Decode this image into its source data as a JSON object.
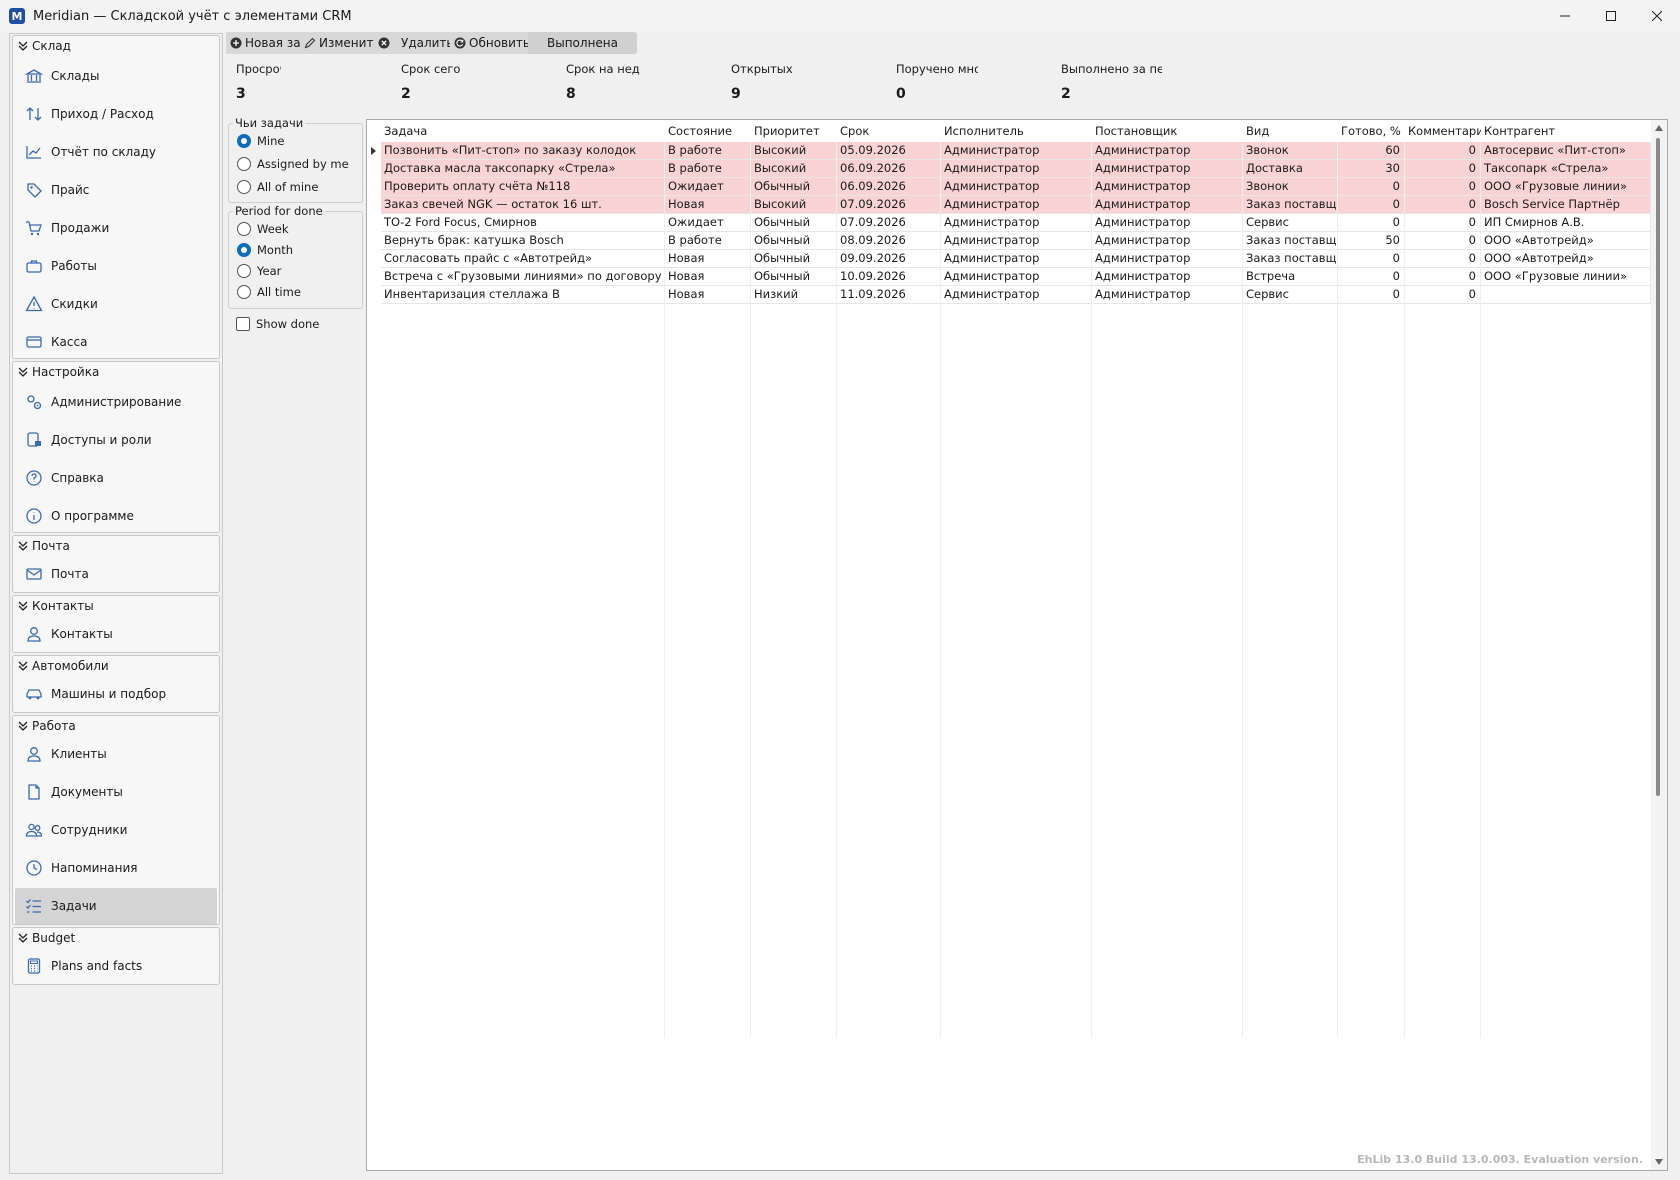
{
  "window": {
    "title": "Meridian — Складской учёт с элементами CRM",
    "icon_letter": "M"
  },
  "nav": {
    "groups": [
      {
        "title": "Склад",
        "items": [
          {
            "label": "Склады",
            "icon": "bank-icon"
          },
          {
            "label": "Приход / Расход",
            "icon": "arrows-updown-icon"
          },
          {
            "label": "Отчёт по складу",
            "icon": "chart-icon"
          },
          {
            "label": "Прайс",
            "icon": "tag-icon"
          },
          {
            "label": "Продажи",
            "icon": "cart-icon"
          },
          {
            "label": "Работы",
            "icon": "briefcase-icon"
          },
          {
            "label": "Скидки",
            "icon": "warning-icon"
          },
          {
            "label": "Касса",
            "icon": "wallet-icon"
          }
        ]
      },
      {
        "title": "Настройка",
        "items": [
          {
            "label": "Администрирование",
            "icon": "gears-icon"
          },
          {
            "label": "Доступы и роли",
            "icon": "user-lock-icon"
          },
          {
            "label": "Справка",
            "icon": "help-icon"
          },
          {
            "label": "О программе",
            "icon": "info-icon"
          }
        ]
      },
      {
        "title": "Почта",
        "items": [
          {
            "label": "Почта",
            "icon": "mail-icon"
          }
        ]
      },
      {
        "title": "Контакты",
        "items": [
          {
            "label": "Контакты",
            "icon": "person-icon"
          }
        ]
      },
      {
        "title": "Автомобили",
        "items": [
          {
            "label": "Машины и подбор",
            "icon": "car-icon"
          }
        ]
      },
      {
        "title": "Работа",
        "items": [
          {
            "label": "Клиенты",
            "icon": "person-icon"
          },
          {
            "label": "Документы",
            "icon": "document-icon"
          },
          {
            "label": "Сотрудники",
            "icon": "people-icon"
          },
          {
            "label": "Напоминания",
            "icon": "clock-icon"
          },
          {
            "label": "Задачи",
            "icon": "tasks-icon",
            "active": true
          }
        ]
      },
      {
        "title": "Budget",
        "items": [
          {
            "label": "Plans and facts",
            "icon": "calculator-icon"
          }
        ]
      }
    ]
  },
  "toolbar": {
    "new_task": "Новая задача",
    "edit": "Изменить",
    "delete": "Удалить",
    "refresh": "Обновить",
    "done": "Выполнена"
  },
  "stats": [
    {
      "label": "Просрочено",
      "value": "3"
    },
    {
      "label": "Срок сегодня",
      "value": "2"
    },
    {
      "label": "Срок на неделе",
      "value": "8"
    },
    {
      "label": "Открытых у меня",
      "value": "9"
    },
    {
      "label": "Поручено мной",
      "value": "0"
    },
    {
      "label": "Выполнено за период",
      "value": "2"
    }
  ],
  "filters": {
    "whose_title": "Чьи задачи",
    "whose_options": [
      "Mine",
      "Assigned by me",
      "All of mine"
    ],
    "whose_selected": 0,
    "period_title": "Period for done",
    "period_options": [
      "Week",
      "Month",
      "Year",
      "All time"
    ],
    "period_selected": 1,
    "show_done_label": "Show done",
    "show_done_checked": false
  },
  "grid": {
    "columns": [
      "Задача",
      "Состояние",
      "Приоритет",
      "Срок",
      "Исполнитель",
      "Постановщик",
      "Вид",
      "Готово, %",
      "Комментарии",
      "Контрагент"
    ],
    "rows": [
      {
        "overdue": true,
        "cells": [
          "Позвонить «Пит-стоп» по заказу колодок",
          "В работе",
          "Высокий",
          "05.09.2026",
          "Администратор",
          "Администратор",
          "Звонок",
          "60",
          "0",
          "Автосервис «Пит-стоп»"
        ]
      },
      {
        "overdue": true,
        "cells": [
          "Доставка масла таксопарку «Стрела»",
          "В работе",
          "Высокий",
          "06.09.2026",
          "Администратор",
          "Администратор",
          "Доставка",
          "30",
          "0",
          "Таксопарк «Стрела»"
        ]
      },
      {
        "overdue": true,
        "cells": [
          "Проверить оплату счёта №118",
          "Ожидает",
          "Обычный",
          "06.09.2026",
          "Администратор",
          "Администратор",
          "Звонок",
          "0",
          "0",
          "ООО «Грузовые линии»"
        ]
      },
      {
        "overdue": true,
        "cells": [
          "Заказ свечей NGK — остаток 16 шт.",
          "Новая",
          "Высокий",
          "07.09.2026",
          "Администратор",
          "Администратор",
          "Заказ поставщику",
          "0",
          "0",
          "Bosch Service Партнёр"
        ]
      },
      {
        "overdue": false,
        "cells": [
          "ТО-2 Ford Focus, Смирнов",
          "Ожидает",
          "Обычный",
          "07.09.2026",
          "Администратор",
          "Администратор",
          "Сервис",
          "0",
          "0",
          "ИП Смирнов А.В."
        ]
      },
      {
        "overdue": false,
        "cells": [
          "Вернуть брак: катушка Bosch",
          "В работе",
          "Обычный",
          "08.09.2026",
          "Администратор",
          "Администратор",
          "Заказ поставщику",
          "50",
          "0",
          "ООО «Автотрейд»"
        ]
      },
      {
        "overdue": false,
        "cells": [
          "Согласовать прайс с «Автотрейд»",
          "Новая",
          "Обычный",
          "09.09.2026",
          "Администратор",
          "Администратор",
          "Заказ поставщику",
          "0",
          "0",
          "ООО «Автотрейд»"
        ]
      },
      {
        "overdue": false,
        "cells": [
          "Встреча с «Грузовыми линиями» по договору",
          "Новая",
          "Обычный",
          "10.09.2026",
          "Администратор",
          "Администратор",
          "Встреча",
          "0",
          "0",
          "ООО «Грузовые линии»"
        ]
      },
      {
        "overdue": false,
        "cells": [
          "Инвентаризация стеллажа B",
          "Новая",
          "Низкий",
          "11.09.2026",
          "Администратор",
          "Администратор",
          "Сервис",
          "0",
          "0",
          ""
        ]
      }
    ]
  },
  "watermark": "EhLib 13.0 Build 13.0.003. Evaluation version."
}
